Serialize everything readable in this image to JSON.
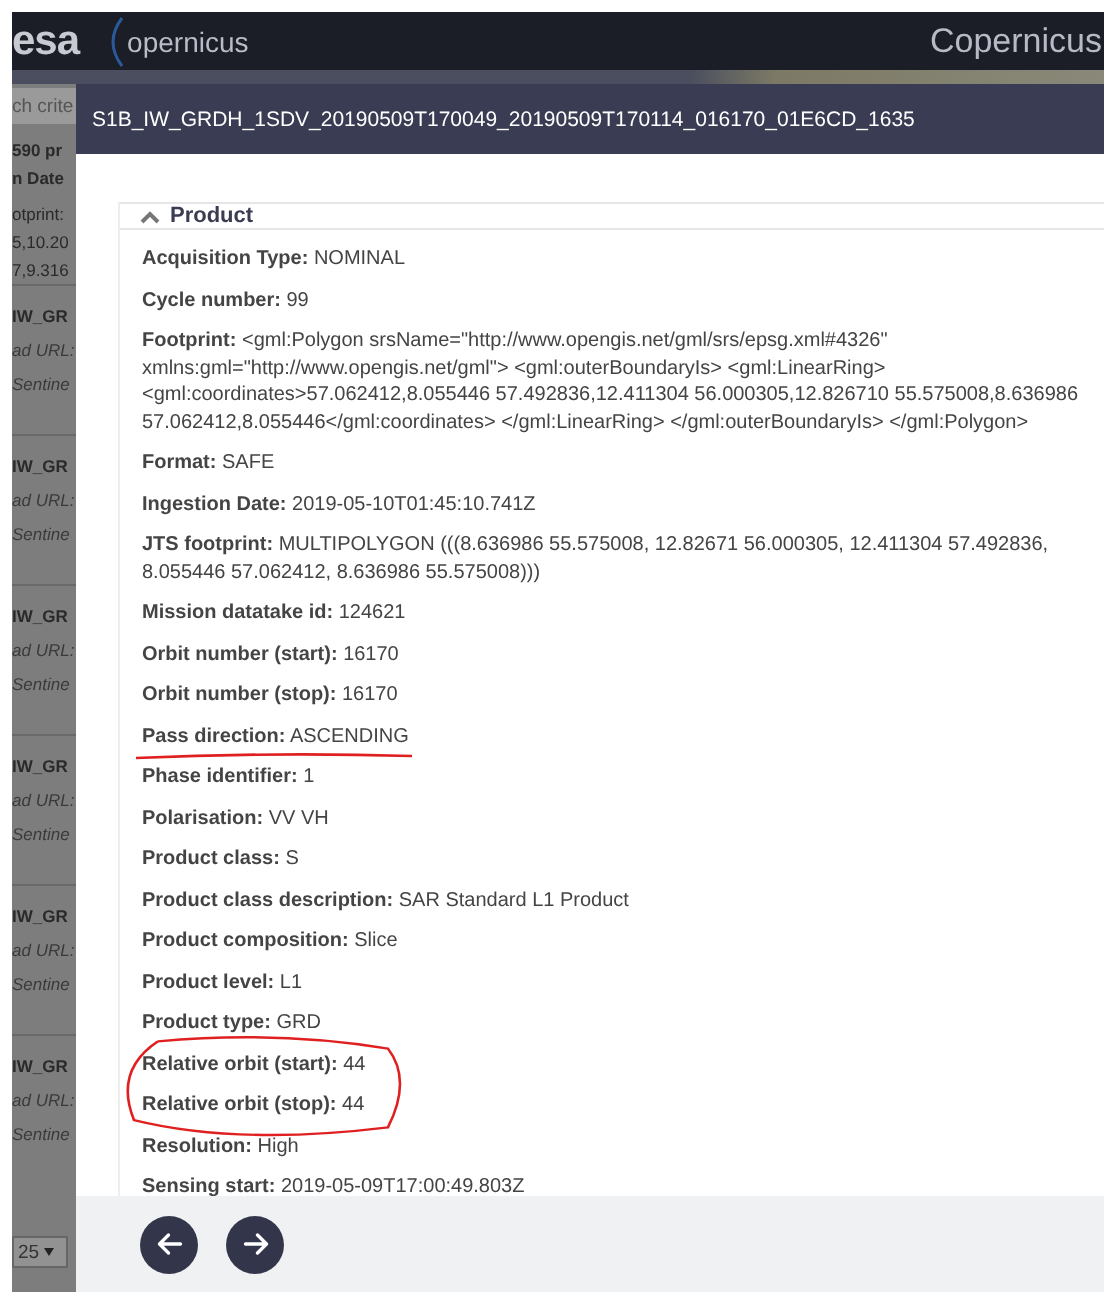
{
  "header": {
    "logo": "esa",
    "brand": "opernicus",
    "title": "Copernicus"
  },
  "sidebar": {
    "search_placeholder": "ch crite",
    "count": "590 pr",
    "sort": "n Date",
    "footprint_lines": [
      "otprint:",
      "5,10.20",
      "7,9.316"
    ],
    "results": [
      {
        "name": "IW_GR",
        "url": "ad URL:",
        "mission": "Sentine"
      },
      {
        "name": "IW_GR",
        "url": "ad URL:",
        "mission": "Sentine"
      },
      {
        "name": "IW_GR",
        "url": "ad URL:",
        "mission": "Sentine"
      },
      {
        "name": "IW_GR",
        "url": "ad URL:",
        "mission": "Sentine"
      },
      {
        "name": "IW_GR",
        "url": "ad URL:",
        "mission": "Sentine"
      },
      {
        "name": "IW_GR",
        "url": "ad URL:",
        "mission": "Sentine"
      }
    ],
    "page_size": "25"
  },
  "dialog": {
    "title": "S1B_IW_GRDH_1SDV_20190509T170049_20190509T170114_016170_01E6CD_1635",
    "section": {
      "title": "Product",
      "expanded": true,
      "rows": [
        {
          "label": "Acquisition Type:",
          "value": "NOMINAL",
          "underlined": false,
          "circled": false
        },
        {
          "label": "Cycle number:",
          "value": "99",
          "underlined": false,
          "circled": false
        },
        {
          "label": "Footprint:",
          "value": "<gml:Polygon srsName=\"http://www.opengis.net/gml/srs/epsg.xml#4326\" xmlns:gml=\"http://www.opengis.net/gml\"> <gml:outerBoundaryIs> <gml:LinearRing> <gml:coordinates>57.062412,8.055446 57.492836,12.411304 56.000305,12.826710 55.575008,8.636986 57.062412,8.055446</gml:coordinates> </gml:LinearRing> </gml:outerBoundaryIs> </gml:Polygon>",
          "underlined": false,
          "circled": false
        },
        {
          "label": "Format:",
          "value": "SAFE",
          "underlined": false,
          "circled": false
        },
        {
          "label": "Ingestion Date:",
          "value": "2019-05-10T01:45:10.741Z",
          "underlined": false,
          "circled": false
        },
        {
          "label": "JTS footprint:",
          "value": "MULTIPOLYGON (((8.636986 55.575008, 12.82671 56.000305, 12.411304 57.492836, 8.055446 57.062412, 8.636986 55.575008)))",
          "underlined": false,
          "circled": false
        },
        {
          "label": "Mission datatake id:",
          "value": "124621",
          "underlined": false,
          "circled": false
        },
        {
          "label": "Orbit number (start):",
          "value": "16170",
          "underlined": false,
          "circled": false
        },
        {
          "label": "Orbit number (stop):",
          "value": "16170",
          "underlined": false,
          "circled": false
        },
        {
          "label": "Pass direction:",
          "value": "ASCENDING",
          "underlined": true,
          "circled": false
        },
        {
          "label": "Phase identifier:",
          "value": "1",
          "underlined": false,
          "circled": false
        },
        {
          "label": "Polarisation:",
          "value": "VV VH",
          "underlined": false,
          "circled": false
        },
        {
          "label": "Product class:",
          "value": "S",
          "underlined": false,
          "circled": false
        },
        {
          "label": "Product class description:",
          "value": "SAR Standard L1 Product",
          "underlined": false,
          "circled": false
        },
        {
          "label": "Product composition:",
          "value": "Slice",
          "underlined": false,
          "circled": false
        },
        {
          "label": "Product level:",
          "value": "L1",
          "underlined": false,
          "circled": false
        },
        {
          "label": "Product type:",
          "value": "GRD",
          "underlined": false,
          "circled": false
        },
        {
          "label": "Relative orbit (start):",
          "value": "44",
          "underlined": false,
          "circled": true
        },
        {
          "label": "Relative orbit (stop):",
          "value": "44",
          "underlined": false,
          "circled": true
        },
        {
          "label": "Resolution:",
          "value": "High",
          "underlined": false,
          "circled": false
        },
        {
          "label": "Sensing start:",
          "value": "2019-05-09T17:00:49.803Z",
          "underlined": false,
          "circled": false
        }
      ]
    }
  },
  "footer": {
    "buttons": [
      {
        "kind": "previous"
      },
      {
        "kind": "next"
      }
    ]
  }
}
